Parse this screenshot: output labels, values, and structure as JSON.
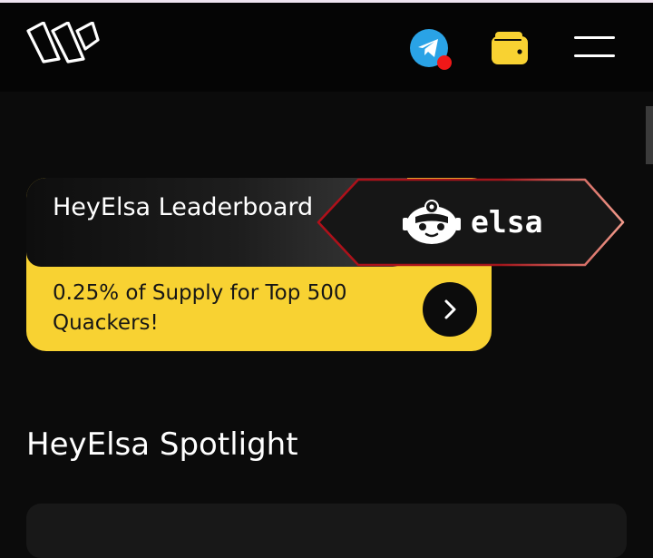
{
  "header": {
    "logo_icon": "brand-logo-icon",
    "telegram_icon": "telegram-icon",
    "wallet_icon": "wallet-icon",
    "menu_icon": "hamburger-menu-icon"
  },
  "leaderboard_card": {
    "title": "HeyElsa Leaderboard",
    "subtitle": "0.25% of Supply for Top 500 Quackers!",
    "badge_word": "elsa",
    "arrow_icon": "chevron-right-icon"
  },
  "spotlight": {
    "title": "HeyElsa Spotlight"
  },
  "colors": {
    "background": "#0b0b0b",
    "card_yellow": "#f8d232",
    "telegram_blue": "#2aa3e6",
    "notification_red": "#f01818",
    "wallet_yellow": "#f8d232"
  }
}
